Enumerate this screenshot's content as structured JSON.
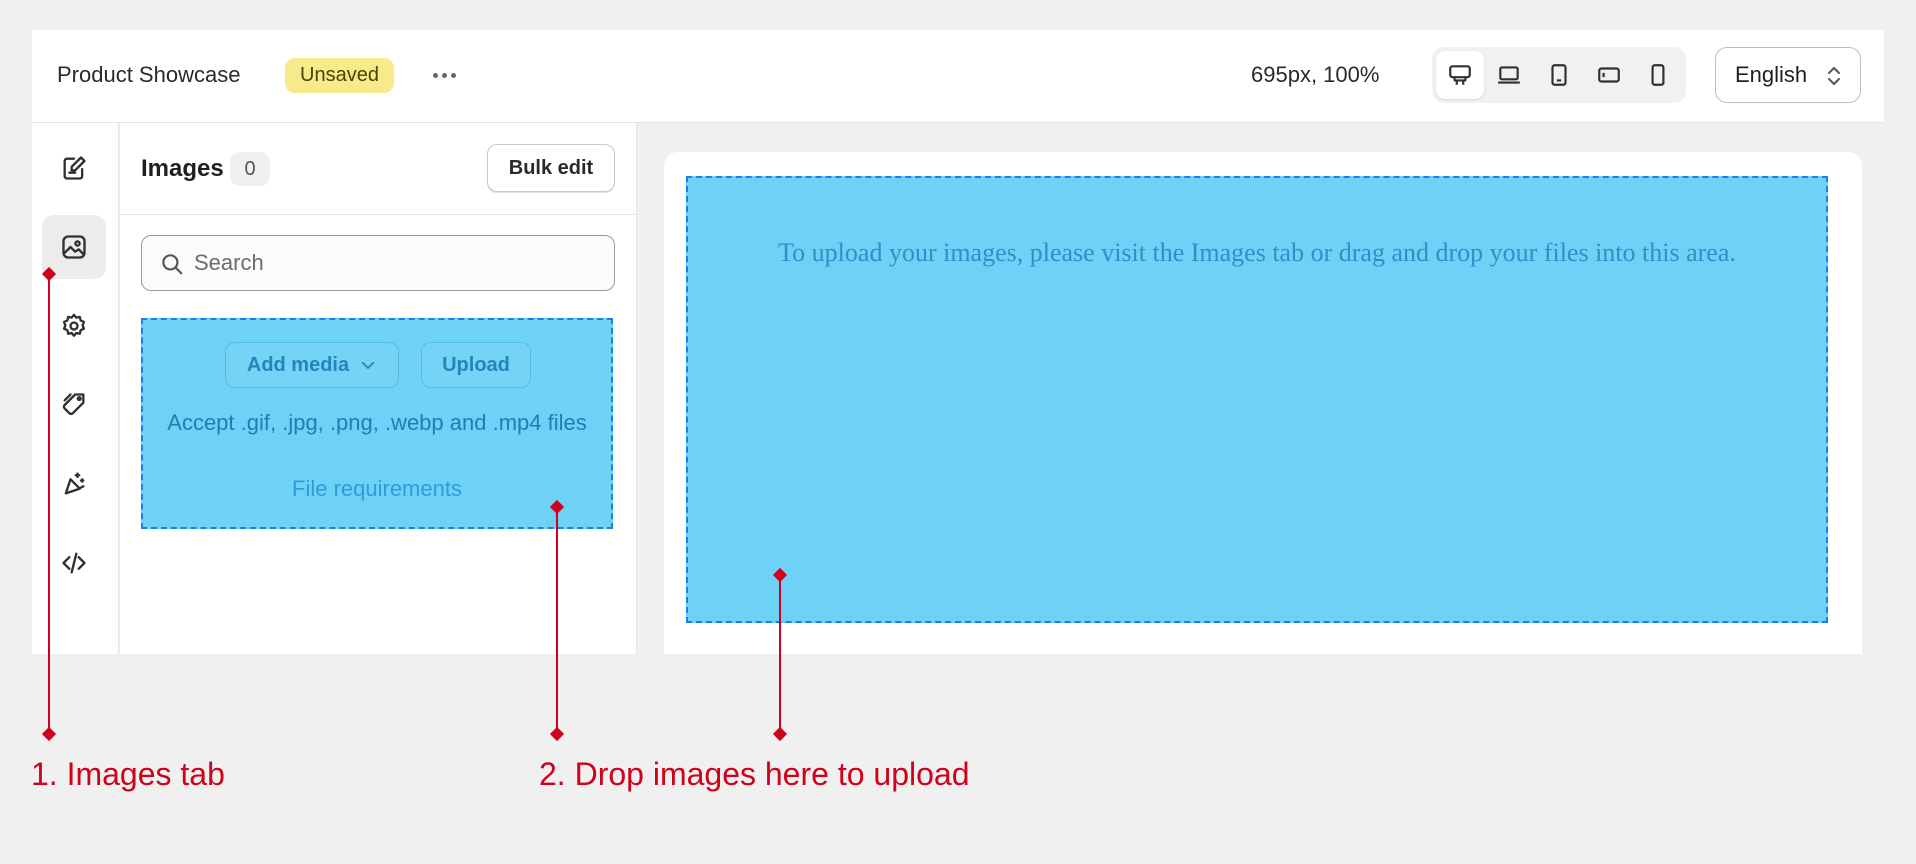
{
  "header": {
    "app_title": "Product Showcase",
    "status_badge": "Unsaved",
    "viewport_readout": "695px, 100%",
    "device_modes": [
      "desktop-icon",
      "laptop-icon",
      "tablet-icon",
      "tablet-landscape-icon",
      "mobile-icon"
    ],
    "active_device": "desktop",
    "language": "English"
  },
  "rail": {
    "items": [
      "edit-icon",
      "images-icon",
      "settings-icon",
      "tag-icon",
      "magic-icon",
      "code-icon"
    ],
    "active": "images"
  },
  "images_panel": {
    "title": "Images",
    "count": "0",
    "bulk_edit_label": "Bulk edit",
    "search": {
      "placeholder": "Search",
      "value": ""
    },
    "dropzone": {
      "add_media_label": "Add media",
      "upload_label": "Upload",
      "accept_text": "Accept .gif, .jpg, .png, .webp and .mp4 files",
      "requirements_link": "File requirements"
    }
  },
  "canvas": {
    "dropzone_text": "To upload your images, please visit the Images tab or drag and drop your files into this area."
  },
  "annotations": [
    {
      "label": "1. Images tab"
    },
    {
      "label": "2. Drop images here to upload"
    }
  ],
  "colors": {
    "dropzone_fill": "#6dd2f5",
    "dropzone_border": "#1a7fe6",
    "annotation": "#d0021b",
    "unsaved_badge": "#f7ea8a"
  }
}
